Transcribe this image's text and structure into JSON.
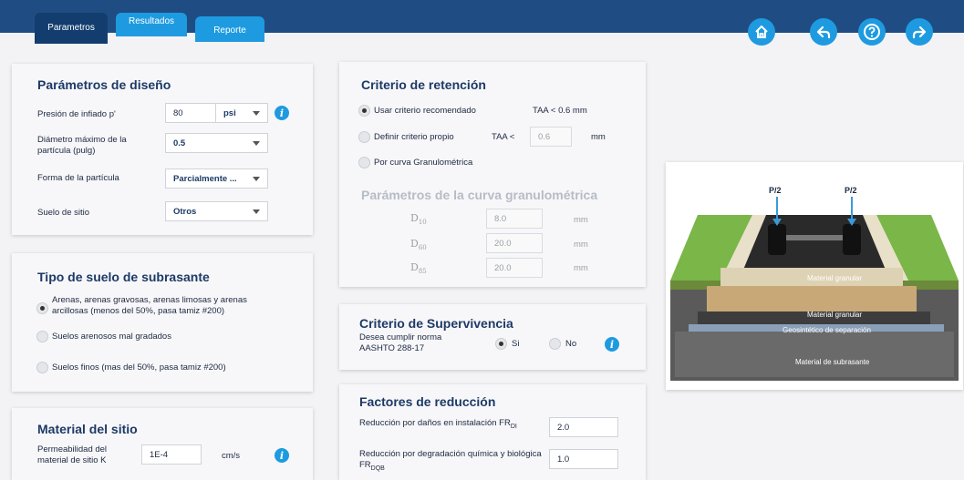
{
  "tabs": {
    "parametros": "Parametros",
    "resultados": "Resultados",
    "reporte": "Reporte"
  },
  "nav_icons": [
    "home-icon",
    "back-icon",
    "help-icon",
    "forward-icon"
  ],
  "parametros_diseno": {
    "title": "Parámetros de diseño",
    "presion_label": "Presión de infiado p'",
    "presion_value": "80",
    "presion_unit": "psi",
    "diametro_label": "Diámetro máximo de la partícula (pulg)",
    "diametro_value": "0.5",
    "forma_label": "Forma de la partícula",
    "forma_value": "Parcialmente ...",
    "suelo_label": "Suelo de sitio",
    "suelo_value": "Otros"
  },
  "tipo_suelo": {
    "title": "Tipo de suelo de subrasante",
    "options": [
      "Arenas, arenas gravosas, arenas limosas y arenas arcillosas (menos del 50%, pasa tamiz #200)",
      "Suelos arenosos mal gradados",
      "Suelos finos (mas del 50%, pasa tamiz #200)"
    ],
    "selected_index": 0
  },
  "material_sitio": {
    "title": "Material del sitio",
    "perm_label": "Permeabilidad del material de sitio K",
    "perm_value": "1E-4",
    "perm_unit": "cm/s"
  },
  "criterio_retencion": {
    "title": "Criterio de retención",
    "opt1": "Usar criterio recomendado",
    "opt1_note": "TAA < 0.6 mm",
    "opt2": "Definir criterio propio",
    "opt2_prefix": "TAA <",
    "opt2_value": "0.6",
    "opt2_unit": "mm",
    "opt3": "Por curva Granulométrica",
    "selected_index": 0
  },
  "curva": {
    "title": "Parámetros de la curva granulométrica",
    "rows": [
      {
        "label": "D",
        "sub": "10",
        "value": "8.0",
        "unit": "mm"
      },
      {
        "label": "D",
        "sub": "60",
        "value": "20.0",
        "unit": "mm"
      },
      {
        "label": "D",
        "sub": "85",
        "value": "20.0",
        "unit": "mm"
      }
    ]
  },
  "supervivencia": {
    "title": "Criterio de Supervivencia",
    "label": "Desea cumplir norma AASHTO 288-17",
    "si": "Si",
    "no": "No",
    "selected": "Si"
  },
  "factores": {
    "title": "Factores de reducción",
    "fr_di_label": "Reducción por daños en instalación FR",
    "fr_di_sub": "DI",
    "fr_di_value": "2.0",
    "fr_dqb_label": "Reducción por degradación química y biológica FR",
    "fr_dqb_sub": "DQB",
    "fr_dqb_value": "1.0"
  },
  "diagram": {
    "p_left": "P/2",
    "p_right": "P/2",
    "layer1": "Material granular",
    "layer2": "Material granular",
    "layer3": "Geosintético de separación",
    "layer4": "Material de subrasante"
  },
  "colors": {
    "header": "#1f4d83",
    "active_tab": "#123d6e",
    "accent": "#1e9be0"
  }
}
